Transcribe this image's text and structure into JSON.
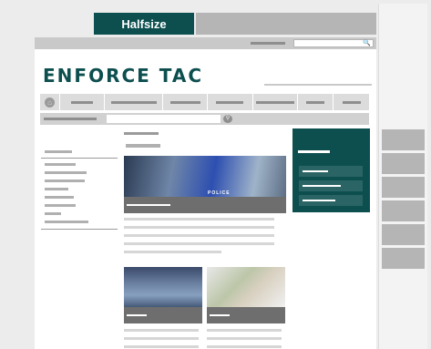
{
  "tabs": {
    "active_label": "Halfsize"
  },
  "brand": {
    "logo_text": "ENFORCE TAC",
    "primary_color": "#0d4f4f"
  },
  "icons": {
    "home": "home-icon",
    "search": "search-icon"
  },
  "hero": {
    "image_text": "POLICE"
  }
}
